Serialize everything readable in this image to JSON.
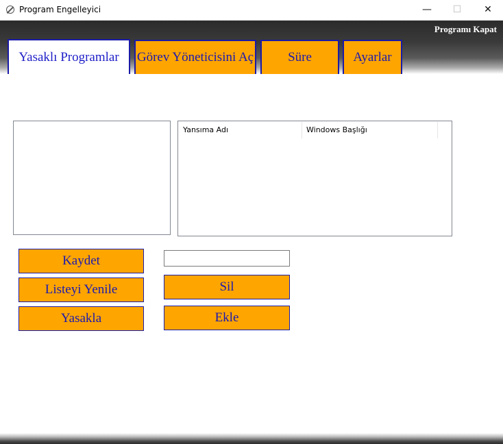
{
  "window": {
    "title": "Program Engelleyici",
    "controls": {
      "minimize": "—",
      "maximize": "☐",
      "close": "✕"
    }
  },
  "header": {
    "close_program_label": "Programı Kapat"
  },
  "tabs": [
    {
      "label": "Yasaklı Programlar",
      "active": true
    },
    {
      "label": "Görev Yöneticisini Aç",
      "active": false
    },
    {
      "label": "Süre",
      "active": false
    },
    {
      "label": "Ayarlar",
      "active": false
    }
  ],
  "listview": {
    "columns": [
      "Yansıma Adı",
      "Windows Başlığı"
    ]
  },
  "textbox": {
    "value": ""
  },
  "buttons": {
    "save": "Kaydet",
    "refresh_list": "Listeyi Yenile",
    "ban": "Yasakla",
    "delete": "Sil",
    "add": "Ekle"
  },
  "colors": {
    "accent": "#ffa500",
    "button_text": "#1a1ab0",
    "border": "#1a1aa8"
  }
}
